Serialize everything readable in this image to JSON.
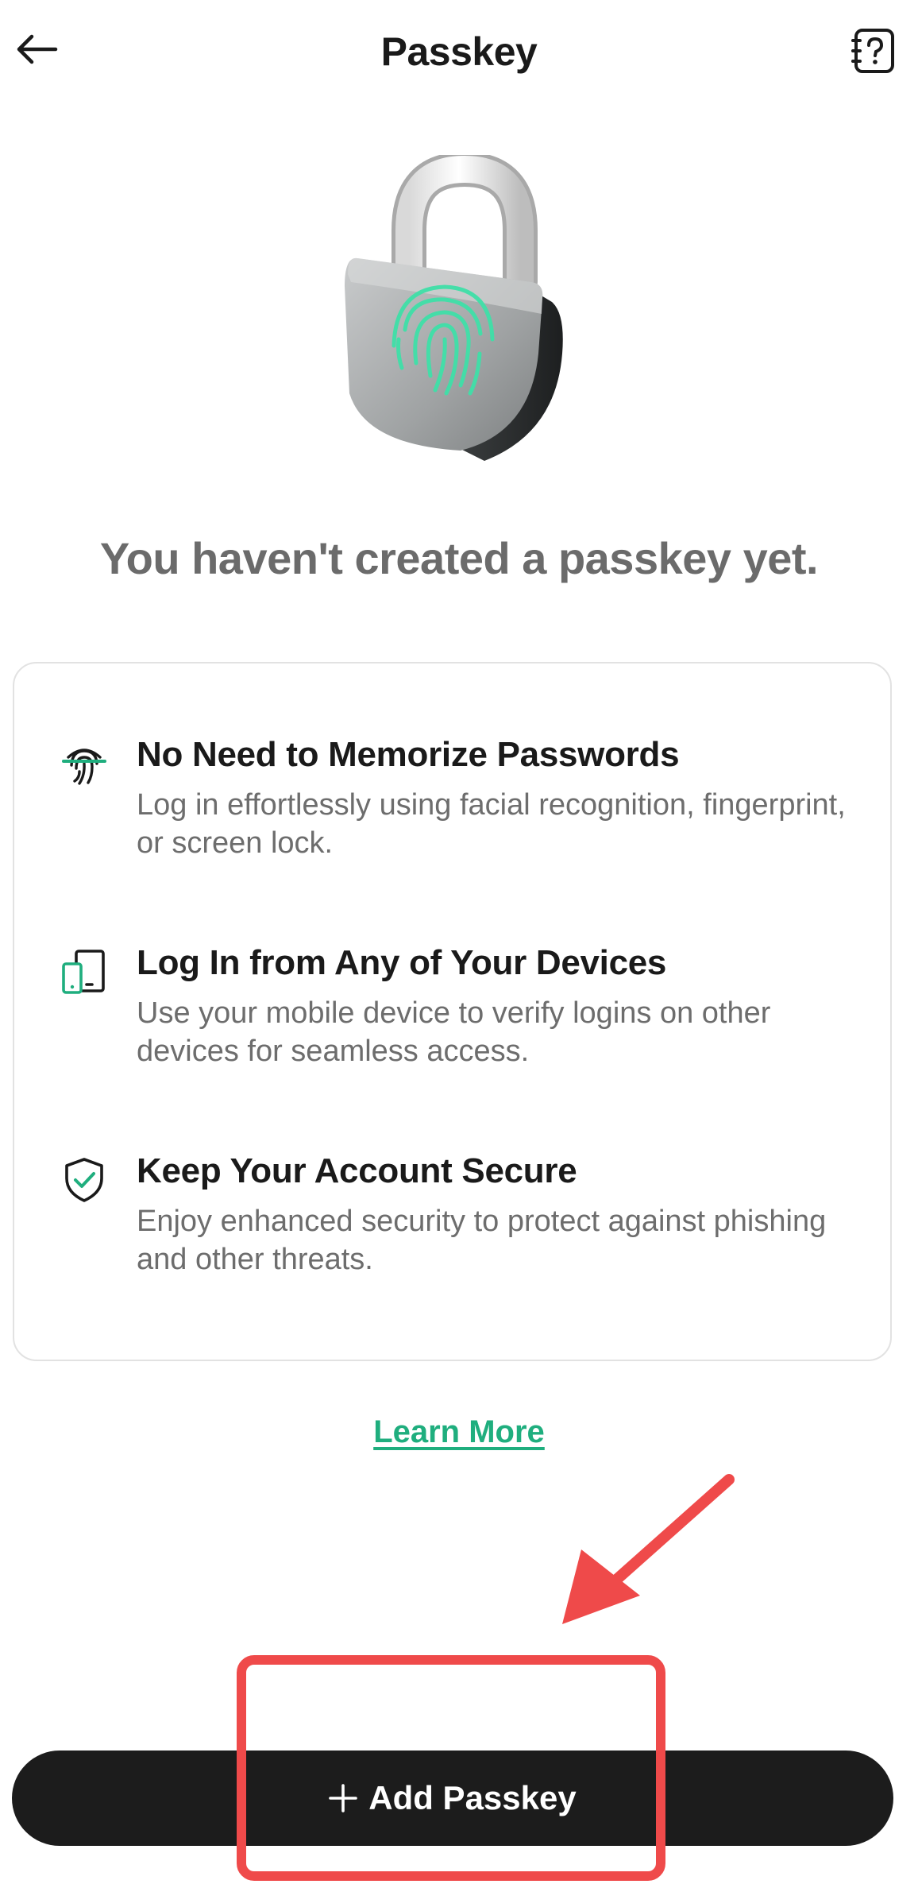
{
  "header": {
    "title": "Passkey",
    "back_icon": "arrow-left-icon",
    "help_icon": "help-book-icon"
  },
  "hero": {
    "illustration": "padlock-fingerprint-icon"
  },
  "empty_state": {
    "heading": "You haven't created a passkey yet."
  },
  "features": [
    {
      "icon": "fingerprint-icon",
      "title": "No Need to Memorize Passwords",
      "description": "Log in effortlessly using facial recognition, fingerprint, or screen lock."
    },
    {
      "icon": "devices-icon",
      "title": "Log In from Any of Your Devices",
      "description": "Use your mobile device to verify logins on other devices for seamless access."
    },
    {
      "icon": "shield-check-icon",
      "title": "Keep Your Account Secure",
      "description": "Enjoy enhanced security to protect against phishing and other threats."
    }
  ],
  "learn_more": {
    "label": "Learn More"
  },
  "primary_action": {
    "label": "Add Passkey",
    "icon": "plus-icon"
  },
  "colors": {
    "accent": "#1fae7e",
    "button_bg": "#1c1c1c",
    "annotation": "#ef4a4a"
  }
}
